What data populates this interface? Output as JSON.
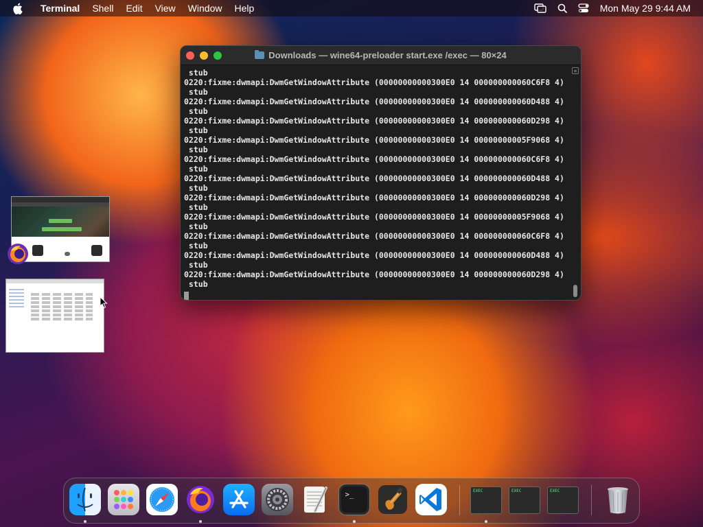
{
  "menubar": {
    "app_name": "Terminal",
    "items": [
      "Shell",
      "Edit",
      "View",
      "Window",
      "Help"
    ],
    "clock": "Mon May 29  9:44 AM"
  },
  "terminal": {
    "title": "Downloads — wine64-preloader start.exe /exec — 80×24",
    "lines": [
      " stub",
      "0220:fixme:dwmapi:DwmGetWindowAttribute (00000000000300E0 14 000000000060C6F8 4)",
      " stub",
      "0220:fixme:dwmapi:DwmGetWindowAttribute (00000000000300E0 14 000000000060D488 4)",
      " stub",
      "0220:fixme:dwmapi:DwmGetWindowAttribute (00000000000300E0 14 000000000060D298 4)",
      " stub",
      "0220:fixme:dwmapi:DwmGetWindowAttribute (00000000000300E0 14 00000000005F9068 4)",
      " stub",
      "0220:fixme:dwmapi:DwmGetWindowAttribute (00000000000300E0 14 000000000060C6F8 4)",
      " stub",
      "0220:fixme:dwmapi:DwmGetWindowAttribute (00000000000300E0 14 000000000060D488 4)",
      " stub",
      "0220:fixme:dwmapi:DwmGetWindowAttribute (00000000000300E0 14 000000000060D298 4)",
      " stub",
      "0220:fixme:dwmapi:DwmGetWindowAttribute (00000000000300E0 14 00000000005F9068 4)",
      " stub",
      "0220:fixme:dwmapi:DwmGetWindowAttribute (00000000000300E0 14 000000000060C6F8 4)",
      " stub",
      "0220:fixme:dwmapi:DwmGetWindowAttribute (00000000000300E0 14 000000000060D488 4)",
      " stub",
      "0220:fixme:dwmapi:DwmGetWindowAttribute (00000000000300E0 14 000000000060D298 4)",
      " stub"
    ]
  },
  "dock": {
    "apps": [
      "finder-icon",
      "launchpad-icon",
      "safari-icon",
      "firefox-icon",
      "app-store-icon",
      "system-preferences-icon",
      "textedit-icon",
      "terminal-icon",
      "garageband-icon",
      "vscode-icon"
    ],
    "exec_windows": [
      "exec",
      "exec",
      "exec"
    ],
    "exec_label": "EXEC"
  },
  "colors": {
    "close": "#ff5f57",
    "minimize": "#febc2e",
    "maximize": "#28c840",
    "terminal_bg": "#1e1e1e"
  }
}
